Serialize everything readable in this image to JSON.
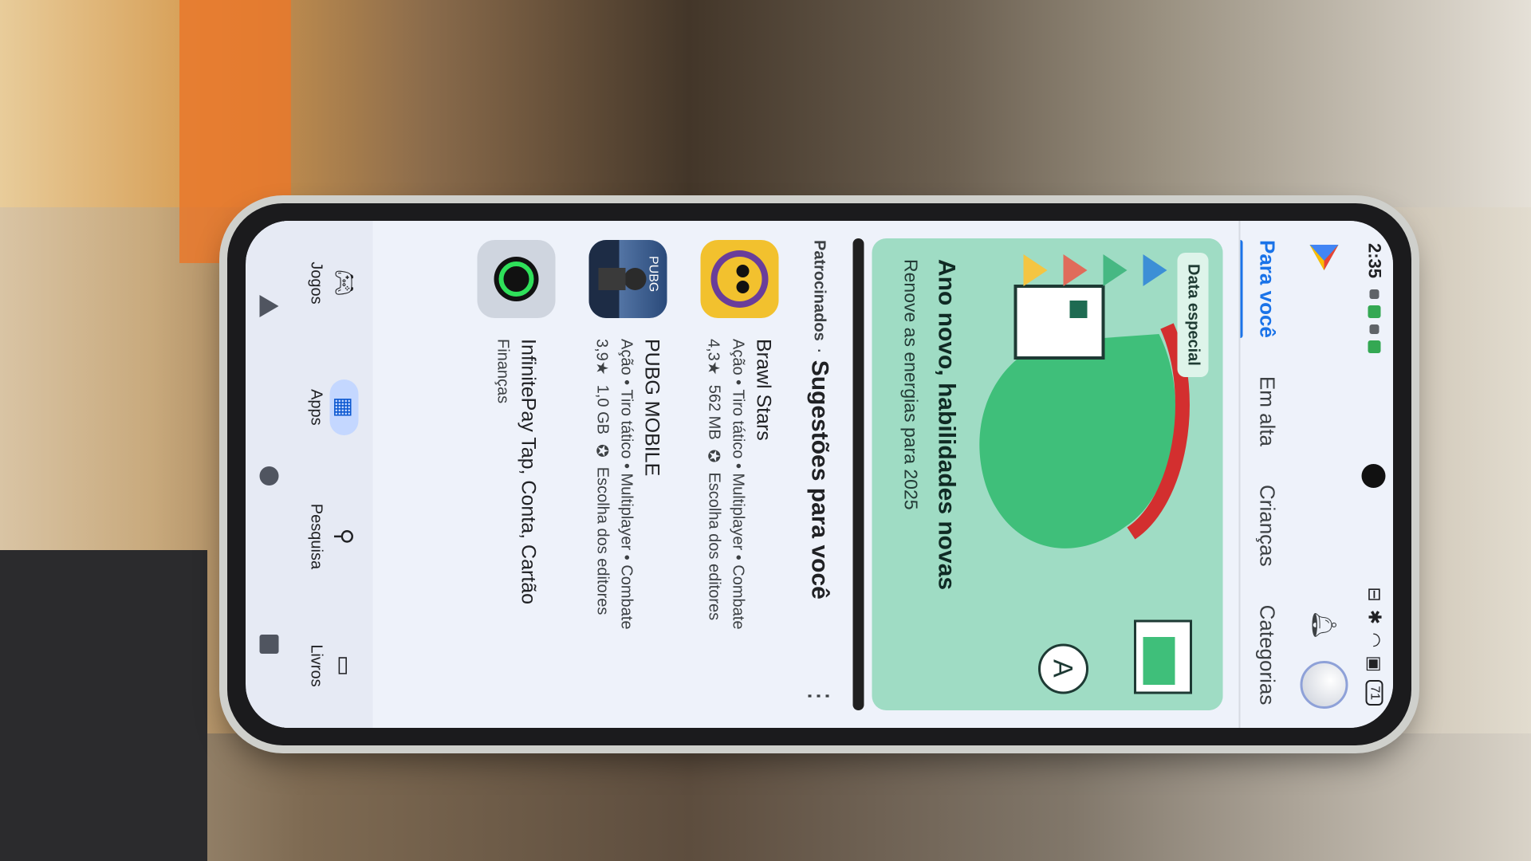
{
  "status_bar": {
    "time": "2:35",
    "battery": "71"
  },
  "tabs": [
    {
      "label": "Para você"
    },
    {
      "label": "Em alta"
    },
    {
      "label": "Crianças"
    },
    {
      "label": "Categorias"
    }
  ],
  "banner": {
    "chip": "Data especial",
    "title": "Ano novo, habilidades novas",
    "subtitle": "Renove as energias para 2025"
  },
  "section": {
    "sponsored": "Patrocinados",
    "separator": "·",
    "title": "Sugestões para você",
    "more": "⋮"
  },
  "apps": [
    {
      "name": "Brawl Stars",
      "tags": "Ação • Tiro tático • Multiplayer • Combate",
      "rating": "4,3★",
      "size": "562 MB",
      "badge": "Escolha dos editores"
    },
    {
      "name": "PUBG MOBILE",
      "tags": "Ação • Tiro tático • Multiplayer • Combate",
      "rating": "3,9★",
      "size": "1,0 GB",
      "badge": "Escolha dos editores"
    },
    {
      "name": "InfinitePay Tap, Conta, Cartão",
      "tags": "Finanças"
    }
  ],
  "bottom_nav": [
    {
      "label": "Jogos",
      "icon": "gamepad-icon"
    },
    {
      "label": "Apps",
      "icon": "apps-grid-icon"
    },
    {
      "label": "Pesquisa",
      "icon": "search-icon"
    },
    {
      "label": "Livros",
      "icon": "book-icon"
    }
  ],
  "colors": {
    "accent": "#1a73e8",
    "banner_bg": "#9fdcc4",
    "nav_active": "#c4d7ff"
  }
}
